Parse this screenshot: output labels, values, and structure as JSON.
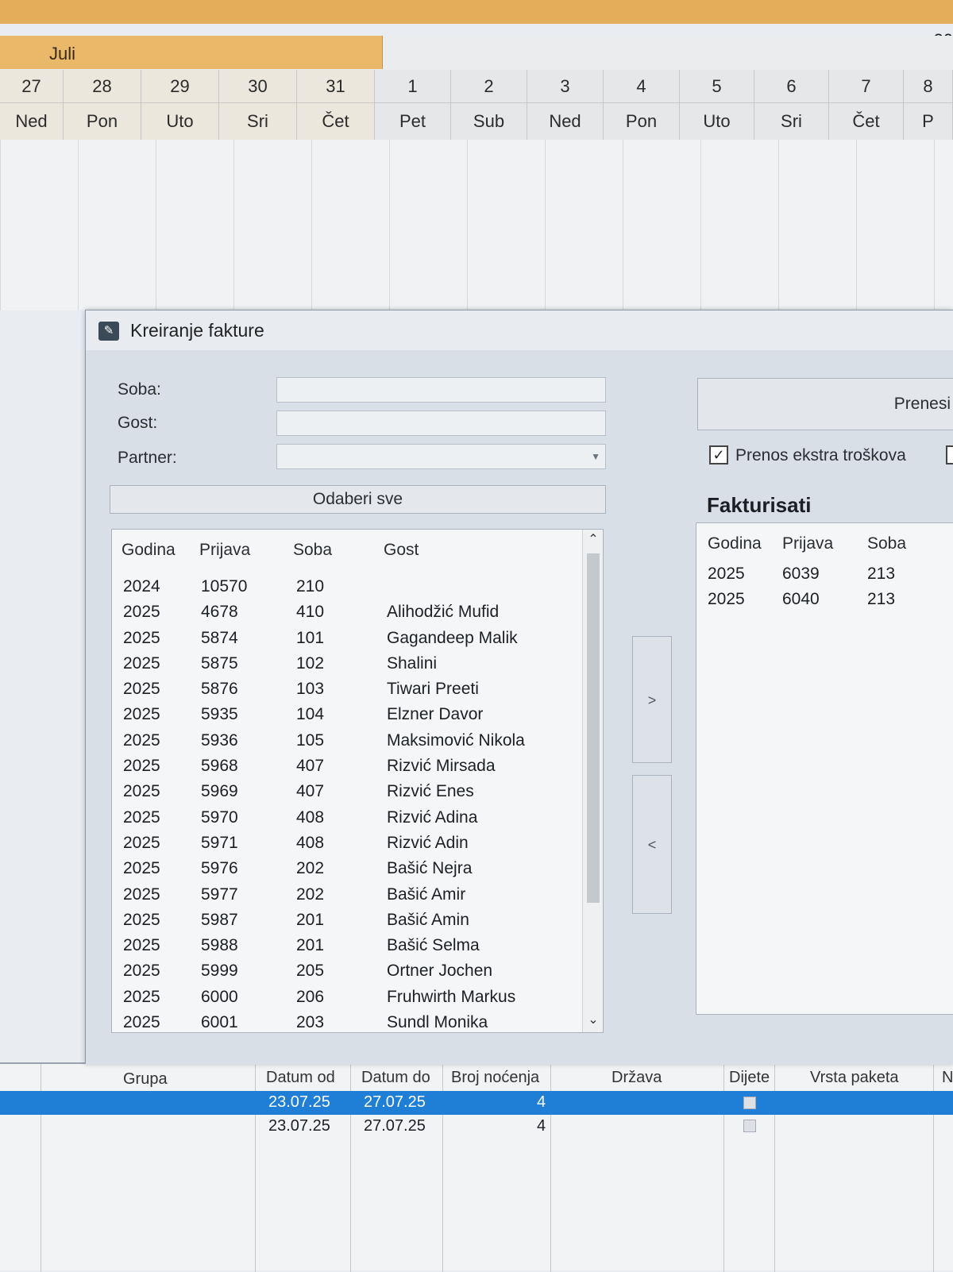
{
  "calendar": {
    "year": "20",
    "month": "Juli",
    "days": [
      {
        "num": "27",
        "name": "Ned",
        "month": "jul"
      },
      {
        "num": "28",
        "name": "Pon",
        "month": "jul"
      },
      {
        "num": "29",
        "name": "Uto",
        "month": "jul"
      },
      {
        "num": "30",
        "name": "Sri",
        "month": "jul"
      },
      {
        "num": "31",
        "name": "Čet",
        "month": "jul"
      },
      {
        "num": "1",
        "name": "Pet",
        "month": "aug"
      },
      {
        "num": "2",
        "name": "Sub",
        "month": "aug"
      },
      {
        "num": "3",
        "name": "Ned",
        "month": "aug"
      },
      {
        "num": "4",
        "name": "Pon",
        "month": "aug"
      },
      {
        "num": "5",
        "name": "Uto",
        "month": "aug"
      },
      {
        "num": "6",
        "name": "Sri",
        "month": "aug"
      },
      {
        "num": "7",
        "name": "Čet",
        "month": "aug"
      },
      {
        "num": "8",
        "name": "P",
        "month": "aug"
      }
    ]
  },
  "dialog": {
    "title": "Kreiranje fakture",
    "icon": "app-icon",
    "labels": {
      "room": "Soba:",
      "guest": "Gost:",
      "partner": "Partner:"
    },
    "room_value": "",
    "guest_value": "",
    "partner_value": "",
    "select_all": "Odaberi sve",
    "move_right": ">",
    "move_left": "<",
    "transfer_button": "Prenesi",
    "extra_costs_label": "Prenos ekstra troškova",
    "extra_costs_checked": true,
    "invoice_title": "Fakturisati",
    "left_columns": [
      "Godina",
      "Prijava",
      "Soba",
      "Gost"
    ],
    "left_rows": [
      [
        "2024",
        "10570",
        "210",
        ""
      ],
      [
        "2025",
        "4678",
        "410",
        "Alihodžić Mufid"
      ],
      [
        "2025",
        "5874",
        "101",
        "Gagandeep Malik"
      ],
      [
        "2025",
        "5875",
        "102",
        "Shalini"
      ],
      [
        "2025",
        "5876",
        "103",
        "Tiwari Preeti"
      ],
      [
        "2025",
        "5935",
        "104",
        "Elzner Davor"
      ],
      [
        "2025",
        "5936",
        "105",
        "Maksimović Nikola"
      ],
      [
        "2025",
        "5968",
        "407",
        "Rizvić Mirsada"
      ],
      [
        "2025",
        "5969",
        "407",
        "Rizvić Enes"
      ],
      [
        "2025",
        "5970",
        "408",
        "Rizvić Adina"
      ],
      [
        "2025",
        "5971",
        "408",
        "Rizvić Adin"
      ],
      [
        "2025",
        "5976",
        "202",
        "Bašić Nejra"
      ],
      [
        "2025",
        "5977",
        "202",
        "Bašić Amir"
      ],
      [
        "2025",
        "5987",
        "201",
        "Bašić Amin"
      ],
      [
        "2025",
        "5988",
        "201",
        "Bašić Selma"
      ],
      [
        "2025",
        "5999",
        "205",
        "Ortner Jochen"
      ],
      [
        "2025",
        "6000",
        "206",
        "Fruhwirth Markus"
      ],
      [
        "2025",
        "6001",
        "203",
        "Sundl Monika"
      ]
    ],
    "right_columns": [
      "Godina",
      "Prijava",
      "Soba"
    ],
    "right_rows": [
      [
        "2025",
        "6039",
        "213"
      ],
      [
        "2025",
        "6040",
        "213"
      ]
    ]
  },
  "bottom_table": {
    "columns": [
      "Grupa",
      "Datum od",
      "Datum do",
      "Broj noćenja",
      "Država",
      "Dijete",
      "Vrsta paketa",
      "N"
    ],
    "rows": [
      {
        "datum_od": "23.07.25",
        "datum_do": "27.07.25",
        "nocenja": "4",
        "selected": true
      },
      {
        "datum_od": "23.07.25",
        "datum_do": "27.07.25",
        "nocenja": "4",
        "selected": false
      }
    ]
  },
  "colors": {
    "selection": "#1f7fd6",
    "month_header": "#e9b868"
  }
}
